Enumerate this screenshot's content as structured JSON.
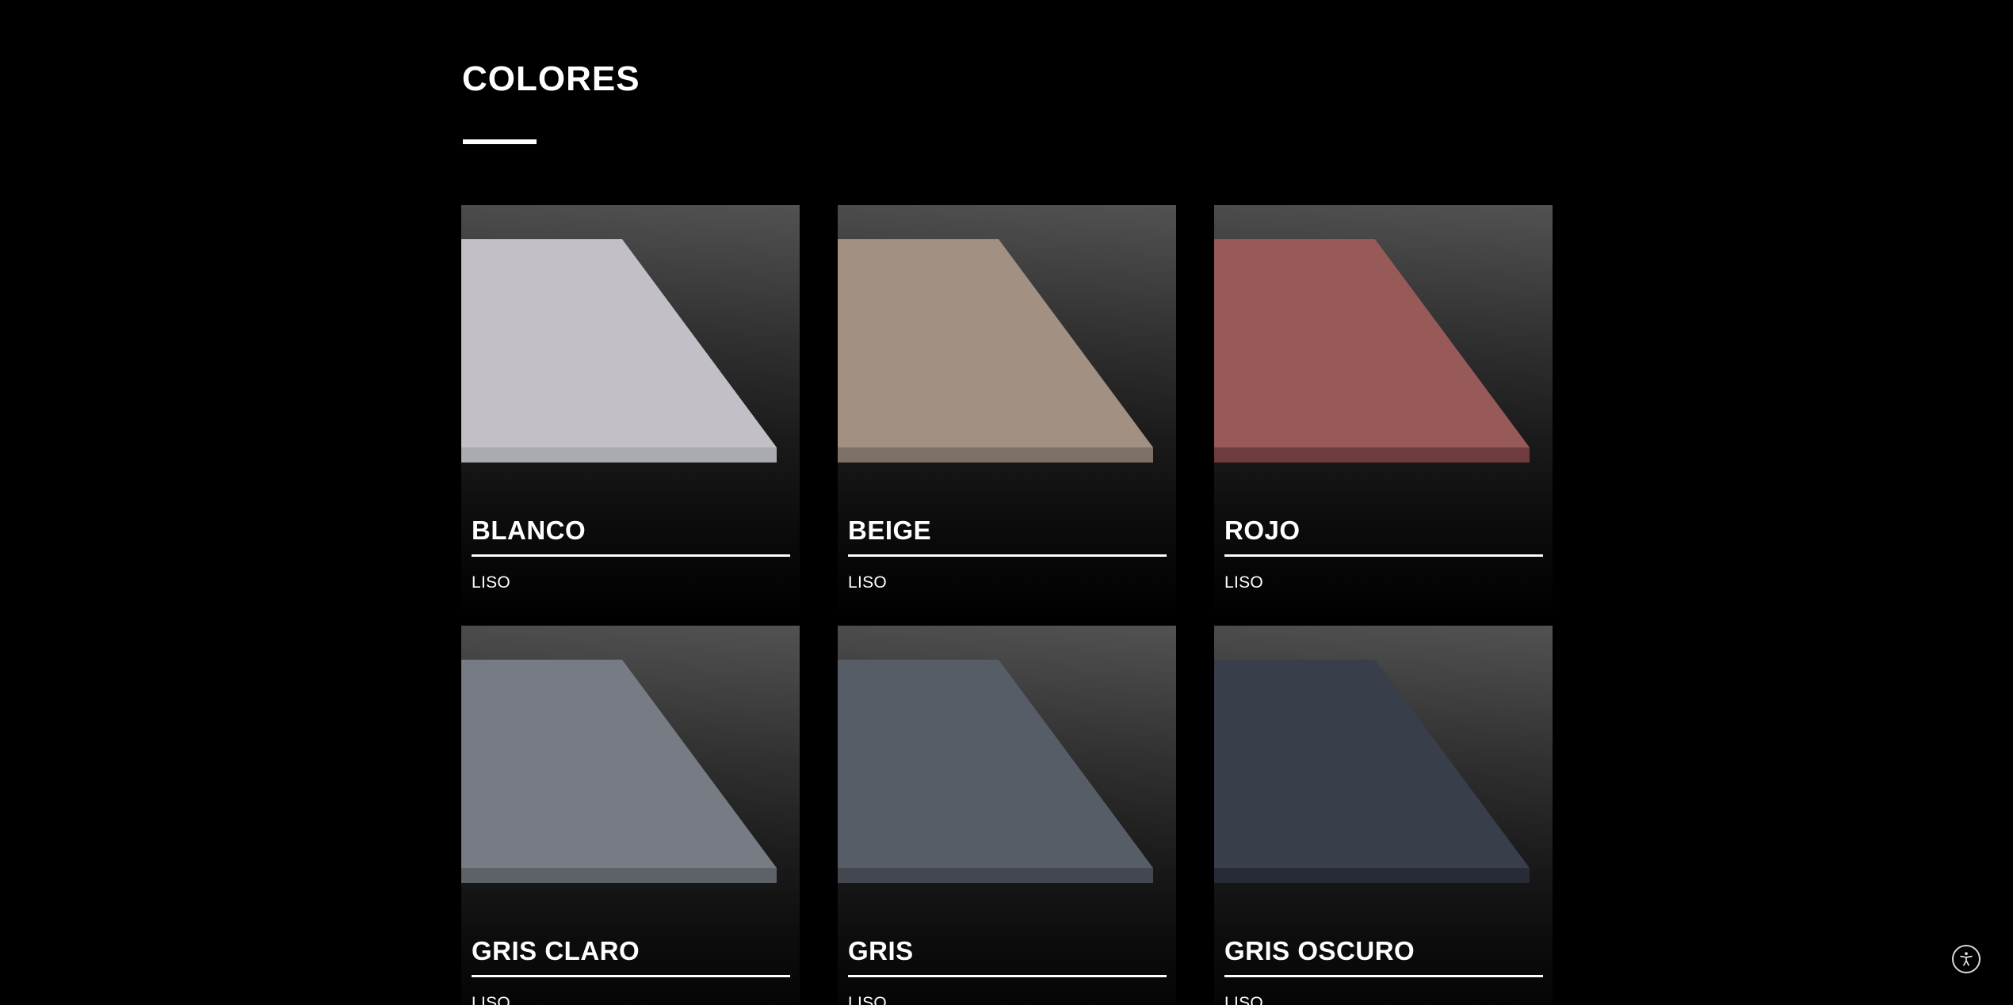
{
  "section": {
    "title": "COLORES"
  },
  "cards": [
    {
      "name": "BLANCO",
      "finish": "LISO",
      "top_color": "#c2c0c6",
      "edge_color": "#a9abb0"
    },
    {
      "name": "BEIGE",
      "finish": "LISO",
      "top_color": "#a29083",
      "edge_color": "#7e7167"
    },
    {
      "name": "ROJO",
      "finish": "LISO",
      "top_color": "#975a58",
      "edge_color": "#6f3c3d"
    },
    {
      "name": "GRIS CLARO",
      "finish": "LISO",
      "top_color": "#767b84",
      "edge_color": "#5d6269"
    },
    {
      "name": "GRIS",
      "finish": "LISO",
      "top_color": "#575d67",
      "edge_color": "#434850"
    },
    {
      "name": "GRIS OSCURO",
      "finish": "LISO",
      "top_color": "#393e4b",
      "edge_color": "#262b35"
    }
  ],
  "accessibility": {
    "icon": "accessibility-icon"
  }
}
